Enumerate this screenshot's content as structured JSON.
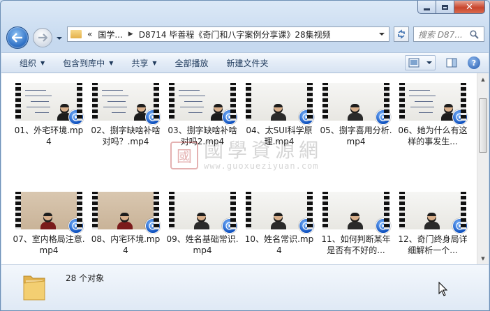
{
  "window": {
    "close_glyph": "✕"
  },
  "address": {
    "prefix": "«",
    "crumbs": [
      "国学...",
      "D8714 毕善程《奇门和八字案例分享课》28集视频"
    ]
  },
  "search": {
    "placeholder": "搜索 D87..."
  },
  "toolbar": {
    "organize": "组织",
    "include_library": "包含到库中",
    "share": "共享",
    "play_all": "全部播放",
    "new_folder": "新建文件夹",
    "help": "?"
  },
  "watermark": {
    "seal": "國",
    "title": "國學資源網",
    "url": "www.guoxueziyuan.com"
  },
  "files": [
    {
      "name": "01、外宅环境.mp4",
      "scene": "board"
    },
    {
      "name": "02、捌字缺啥补啥对吗？.mp4",
      "scene": "board"
    },
    {
      "name": "03、捌字缺啥补啥对吗2.mp4",
      "scene": "board"
    },
    {
      "name": "04、太SUI科学原理.mp4",
      "scene": "portrait"
    },
    {
      "name": "05、捌字喜用分析.mp4",
      "scene": "portrait"
    },
    {
      "name": "06、她为什么有这样的事发生...",
      "scene": "board"
    },
    {
      "name": "07、室内格局注意.mp4",
      "scene": "red"
    },
    {
      "name": "08、内宅环境.mp4",
      "scene": "red"
    },
    {
      "name": "09、姓名基础常识.mp4",
      "scene": "portrait"
    },
    {
      "name": "10、姓名常识.mp4",
      "scene": "portrait"
    },
    {
      "name": "11、如何判断某年是否有不好的...",
      "scene": "portrait"
    },
    {
      "name": "12、奇门终身局详细解析一个...",
      "scene": "portrait"
    }
  ],
  "status": {
    "count_text": "28 个对象"
  },
  "colors": {
    "accent": "#1e395b",
    "window_frame": "#c6d9ef"
  }
}
